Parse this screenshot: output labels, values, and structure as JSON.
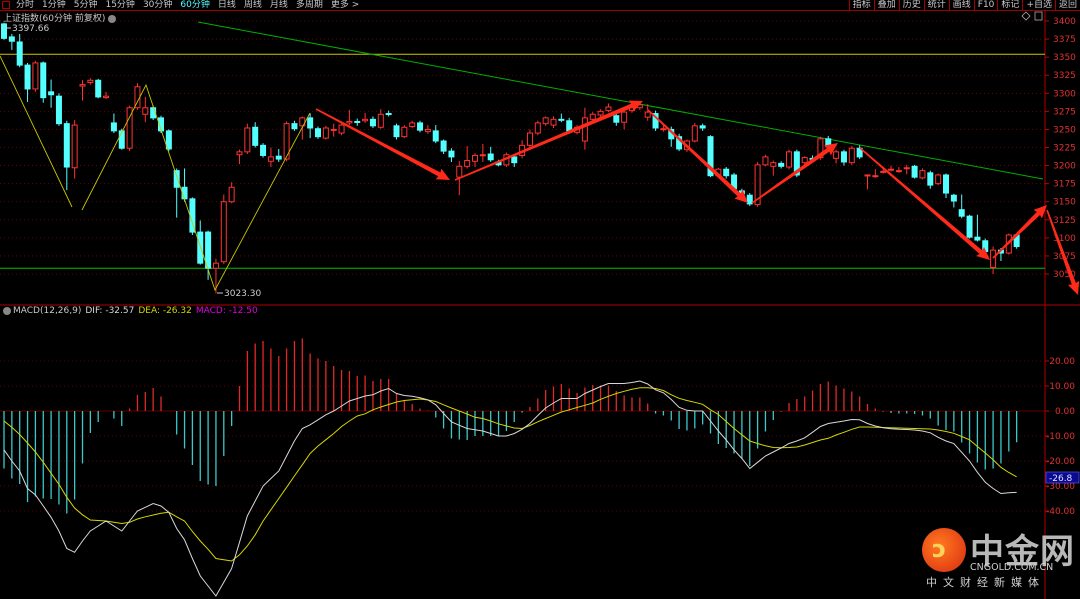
{
  "toolbar": {
    "tabs": [
      "分时",
      "1分钟",
      "5分钟",
      "15分钟",
      "30分钟",
      "60分钟",
      "日线",
      "周线",
      "月线",
      "多周期",
      "更多 >"
    ],
    "active_tab": "60分钟",
    "right_buttons": [
      "指标",
      "叠加",
      "历史",
      "统计",
      "画线",
      "F10",
      "标记",
      "+自选",
      "返回"
    ]
  },
  "title": "上证指数(60分钟 前复权)",
  "price_panel": {
    "high_label": "3397.66",
    "low_label": "3023.30",
    "y_ticks": [
      "3400",
      "3375",
      "3350",
      "3325",
      "3300",
      "3275",
      "3250",
      "3225",
      "3200",
      "3175",
      "3150",
      "3125",
      "3100",
      "3075",
      "3050"
    ],
    "icons": [
      "diamond-icon",
      "panel-toggle-icon"
    ]
  },
  "macd_panel": {
    "label": "MACD(12,26,9)",
    "dif_label": "DIF: -32.57",
    "dea_label": "DEA: -26.32",
    "macd_label": "MACD: -12.50",
    "y_ticks": [
      "20.00",
      "10.00",
      "0.00",
      "-10.00",
      "-20.00",
      "-30.00",
      "-40.00"
    ],
    "cursor_value": "-26.8"
  },
  "colors": {
    "up": "#ff3232",
    "down": "#54ffff",
    "dif": "#d8d8d8",
    "dea": "#d6d600",
    "macd_label": "#e000e0",
    "grid": "#7a0000",
    "trendline": "#00b000",
    "support": "#00c000",
    "resistance": "#c8c800",
    "arrow": "#ff2a1a"
  },
  "watermark": {
    "name": "中金网",
    "domain": "CNGOLD.COM.CN",
    "tagline": "中文财经新媒体"
  },
  "chart_data": [
    {
      "type": "candlestick",
      "title": "上证指数(60分钟 前复权)",
      "ylim": [
        3020,
        3405
      ],
      "grid": true,
      "annotations": {
        "max": 3397.66,
        "min": 3023.3,
        "resistance_level": 3354,
        "support_level": 3058
      },
      "ohlc": [
        [
          3396,
          3397.66,
          3374,
          3376
        ],
        [
          3378,
          3382,
          3360,
          3372
        ],
        [
          3371,
          3382,
          3336,
          3339
        ],
        [
          3339,
          3342,
          3288,
          3306
        ],
        [
          3306,
          3345,
          3302,
          3342
        ],
        [
          3342,
          3344,
          3287,
          3294
        ],
        [
          3302,
          3319,
          3280,
          3298
        ],
        [
          3296,
          3300,
          3255,
          3258
        ],
        [
          3258,
          3262,
          3166,
          3198
        ],
        [
          3197,
          3263,
          3182,
          3256
        ],
        [
          3310,
          3318,
          3290,
          3312
        ],
        [
          3315,
          3321,
          3312,
          3318
        ],
        [
          3318,
          3320,
          3293,
          3295
        ],
        [
          3294,
          3302,
          3292,
          3296
        ],
        [
          3259,
          3272,
          3245,
          3248
        ],
        [
          3248,
          3251,
          3222,
          3224
        ],
        [
          3224,
          3283,
          3220,
          3280
        ],
        [
          3280,
          3314,
          3277,
          3309
        ],
        [
          3271,
          3295,
          3260,
          3280
        ],
        [
          3280,
          3283,
          3263,
          3266
        ],
        [
          3266,
          3269,
          3245,
          3248
        ],
        [
          3248,
          3250,
          3220,
          3223
        ],
        [
          3193,
          3196,
          3128,
          3170
        ],
        [
          3170,
          3196,
          3150,
          3154
        ],
        [
          3154,
          3156,
          3104,
          3108
        ],
        [
          3108,
          3124,
          3063,
          3065
        ],
        [
          3108,
          3110,
          3042,
          3058
        ],
        [
          3058,
          3071,
          3023.3,
          3065
        ],
        [
          3067,
          3160,
          3064,
          3150
        ],
        [
          3150,
          3177,
          3148,
          3170
        ],
        [
          3215,
          3222,
          3202,
          3219
        ],
        [
          3219,
          3258,
          3216,
          3252
        ],
        [
          3253,
          3260,
          3225,
          3228
        ],
        [
          3228,
          3231,
          3211,
          3214
        ],
        [
          3206,
          3225,
          3198,
          3212
        ],
        [
          3213,
          3223,
          3205,
          3209
        ],
        [
          3209,
          3261,
          3206,
          3258
        ],
        [
          3258,
          3262,
          3248,
          3251
        ],
        [
          3255,
          3268,
          3236,
          3266
        ],
        [
          3266,
          3272,
          3238,
          3252
        ],
        [
          3251,
          3254,
          3237,
          3240
        ],
        [
          3238,
          3255,
          3236,
          3252
        ],
        [
          3249,
          3258,
          3240,
          3250
        ],
        [
          3245,
          3258,
          3242,
          3256
        ],
        [
          3259,
          3277,
          3256,
          3261
        ],
        [
          3261,
          3265,
          3255,
          3260
        ],
        [
          3262,
          3273,
          3259,
          3264
        ],
        [
          3264,
          3268,
          3252,
          3255
        ],
        [
          3253,
          3278,
          3251,
          3271
        ],
        [
          3272,
          3276,
          3268,
          3271
        ],
        [
          3255,
          3258,
          3236,
          3240
        ],
        [
          3240,
          3256,
          3238,
          3253
        ],
        [
          3254,
          3262,
          3252,
          3259
        ],
        [
          3259,
          3262,
          3246,
          3249
        ],
        [
          3247,
          3256,
          3244,
          3250
        ],
        [
          3248,
          3256,
          3231,
          3234
        ],
        [
          3234,
          3236,
          3216,
          3220
        ],
        [
          3220,
          3224,
          3205,
          3212
        ],
        [
          3184,
          3206,
          3159,
          3199
        ],
        [
          3199,
          3227,
          3196,
          3207
        ],
        [
          3206,
          3217,
          3198,
          3214
        ],
        [
          3214,
          3230,
          3205,
          3215
        ],
        [
          3216,
          3226,
          3205,
          3208
        ],
        [
          3205,
          3208,
          3199,
          3201
        ],
        [
          3201,
          3218,
          3198,
          3215
        ],
        [
          3212,
          3216,
          3198,
          3204
        ],
        [
          3214,
          3235,
          3210,
          3228
        ],
        [
          3228,
          3250,
          3225,
          3245
        ],
        [
          3245,
          3262,
          3242,
          3259
        ],
        [
          3258,
          3268,
          3255,
          3266
        ],
        [
          3256,
          3268,
          3252,
          3264
        ],
        [
          3264,
          3272,
          3260,
          3263
        ],
        [
          3262,
          3266,
          3246,
          3248
        ],
        [
          3246,
          3256,
          3243,
          3253
        ],
        [
          3234,
          3280,
          3222,
          3266
        ],
        [
          3264,
          3274,
          3262,
          3271
        ],
        [
          3270,
          3278,
          3267,
          3275
        ],
        [
          3276,
          3286,
          3274,
          3281
        ],
        [
          3269,
          3272,
          3255,
          3260
        ],
        [
          3260,
          3277,
          3250,
          3274
        ],
        [
          3276,
          3283,
          3273,
          3280
        ],
        [
          3280,
          3289,
          3277,
          3284
        ],
        [
          3267,
          3285,
          3262,
          3274
        ],
        [
          3272,
          3276,
          3248,
          3252
        ],
        [
          3250,
          3258,
          3247,
          3251
        ],
        [
          3250,
          3254,
          3226,
          3237
        ],
        [
          3240,
          3244,
          3220,
          3223
        ],
        [
          3222,
          3236,
          3219,
          3234
        ],
        [
          3234,
          3259,
          3232,
          3255
        ],
        [
          3255,
          3258,
          3248,
          3252
        ],
        [
          3240,
          3242,
          3184,
          3186
        ],
        [
          3186,
          3197,
          3184,
          3195
        ],
        [
          3195,
          3198,
          3182,
          3186
        ],
        [
          3187,
          3190,
          3166,
          3168
        ],
        [
          3165,
          3168,
          3158,
          3161
        ],
        [
          3159,
          3162,
          3144,
          3147
        ],
        [
          3146,
          3205,
          3143,
          3201
        ],
        [
          3201,
          3215,
          3199,
          3212
        ],
        [
          3199,
          3207,
          3186,
          3204
        ],
        [
          3203,
          3206,
          3196,
          3199
        ],
        [
          3198,
          3222,
          3195,
          3219
        ],
        [
          3219,
          3222,
          3184,
          3187
        ],
        [
          3204,
          3213,
          3201,
          3211
        ],
        [
          3210,
          3214,
          3206,
          3209
        ],
        [
          3211,
          3240,
          3208,
          3237
        ],
        [
          3237,
          3241,
          3223,
          3226
        ],
        [
          3210,
          3222,
          3203,
          3219
        ],
        [
          3219,
          3222,
          3200,
          3205
        ],
        [
          3204,
          3227,
          3201,
          3224
        ],
        [
          3224,
          3228,
          3209,
          3212
        ],
        [
          3186,
          3188,
          3167,
          3187
        ],
        [
          3186,
          3195,
          3183,
          3186
        ],
        [
          3191,
          3198,
          3189,
          3192
        ],
        [
          3194,
          3200,
          3192,
          3195
        ],
        [
          3192,
          3198,
          3190,
          3193
        ],
        [
          3196,
          3201,
          3188,
          3197
        ],
        [
          3199,
          3201,
          3182,
          3184
        ],
        [
          3183,
          3196,
          3181,
          3193
        ],
        [
          3190,
          3193,
          3168,
          3173
        ],
        [
          3175,
          3189,
          3173,
          3187
        ],
        [
          3187,
          3189,
          3155,
          3162
        ],
        [
          3159,
          3161,
          3142,
          3151
        ],
        [
          3139,
          3160,
          3127,
          3130
        ],
        [
          3130,
          3132,
          3099,
          3101
        ],
        [
          3101,
          3132,
          3095,
          3097
        ],
        [
          3096,
          3099,
          3079,
          3081
        ],
        [
          3059,
          3088,
          3050,
          3083
        ],
        [
          3083,
          3086,
          3068,
          3079
        ],
        [
          3079,
          3106,
          3077,
          3104
        ],
        [
          3104,
          3106,
          3085,
          3088
        ]
      ]
    },
    {
      "type": "macd",
      "title": "MACD(12,26,9)",
      "ylim": [
        -75,
        40
      ],
      "grid": true,
      "dif": [
        -15.5,
        -20,
        -24,
        -31,
        -33.5,
        -38,
        -42.5,
        -48,
        -55,
        -56.5,
        -52,
        -48,
        -46,
        -44,
        -46,
        -48,
        -44,
        -40,
        -38.5,
        -37,
        -38,
        -40.5,
        -47,
        -51.5,
        -59,
        -66,
        -70,
        -74,
        -68.5,
        -63,
        -52.5,
        -42,
        -36,
        -30,
        -27,
        -24,
        -18,
        -12,
        -7,
        -5.5,
        -3.5,
        -1.5,
        0,
        2,
        4,
        5,
        6,
        6.5,
        8,
        9,
        7,
        6.2,
        5.9,
        5.3,
        4.5,
        2.5,
        -1,
        -4.3,
        -5.7,
        -7,
        -7.5,
        -8,
        -9,
        -10,
        -10,
        -9,
        -7.3,
        -5,
        -1.8,
        1.2,
        3.2,
        5,
        5,
        5,
        7,
        8.4,
        9.8,
        11,
        11,
        11,
        11.4,
        12,
        10.8,
        8.5,
        7.3,
        4.6,
        1.5,
        0.3,
        0,
        0,
        -4,
        -8,
        -11.6,
        -15.5,
        -19,
        -23,
        -20.5,
        -18,
        -16.4,
        -14.8,
        -13,
        -12,
        -10.7,
        -8.5,
        -6.2,
        -5,
        -4.5,
        -4,
        -3.4,
        -3.5,
        -5,
        -6,
        -6.7,
        -7.1,
        -7.3,
        -7.4,
        -7.6,
        -8,
        -8.7,
        -10.5,
        -12,
        -13,
        -16.5,
        -20,
        -24.5,
        -28.5,
        -31,
        -33,
        -32.7,
        -32.57
      ],
      "dea": [
        -4,
        -6.5,
        -9.4,
        -12.8,
        -16.4,
        -20.5,
        -24.9,
        -29.3,
        -34.5,
        -38.8,
        -41.5,
        -43.6,
        -43.8,
        -44,
        -44.5,
        -45,
        -44.5,
        -43.2,
        -42.3,
        -41.6,
        -40.9,
        -40.5,
        -42.3,
        -44,
        -48.2,
        -52,
        -55.3,
        -59,
        -59.5,
        -60,
        -57.5,
        -54,
        -49.5,
        -44,
        -39.5,
        -35,
        -30.5,
        -26,
        -21.5,
        -17,
        -14,
        -11.5,
        -9,
        -6.2,
        -4,
        -2,
        -1.1,
        0.5,
        1.6,
        2.6,
        3.6,
        4.2,
        4.5,
        4.8,
        4.4,
        3.8,
        2.5,
        1.2,
        0,
        -1.2,
        -2.5,
        -3,
        -4,
        -5.1,
        -6,
        -6.8,
        -7,
        -5.8,
        -4.3,
        -3,
        -1.7,
        -0.4,
        0.5,
        1.4,
        2.3,
        3.2,
        4.7,
        5.9,
        7,
        7.9,
        8.7,
        9.3,
        9.3,
        9,
        8.2,
        6.5,
        5.1,
        4.2,
        3.5,
        2.7,
        0.5,
        -1.4,
        -4.2,
        -7,
        -9.5,
        -12,
        -13,
        -13.9,
        -14.6,
        -14.7,
        -14.6,
        -14.4,
        -13.6,
        -12.6,
        -11.6,
        -10.9,
        -9.6,
        -8.5,
        -7.3,
        -6.4,
        -6.4,
        -6.5,
        -6.6,
        -6.7,
        -6.8,
        -6.9,
        -7,
        -7.1,
        -7.2,
        -7.6,
        -8.2,
        -8.9,
        -10.2,
        -11.5,
        -14.2,
        -16.8,
        -19.5,
        -22.5,
        -24.6,
        -26.32
      ],
      "macd_formula": "2*(DIF-DEA)"
    }
  ]
}
